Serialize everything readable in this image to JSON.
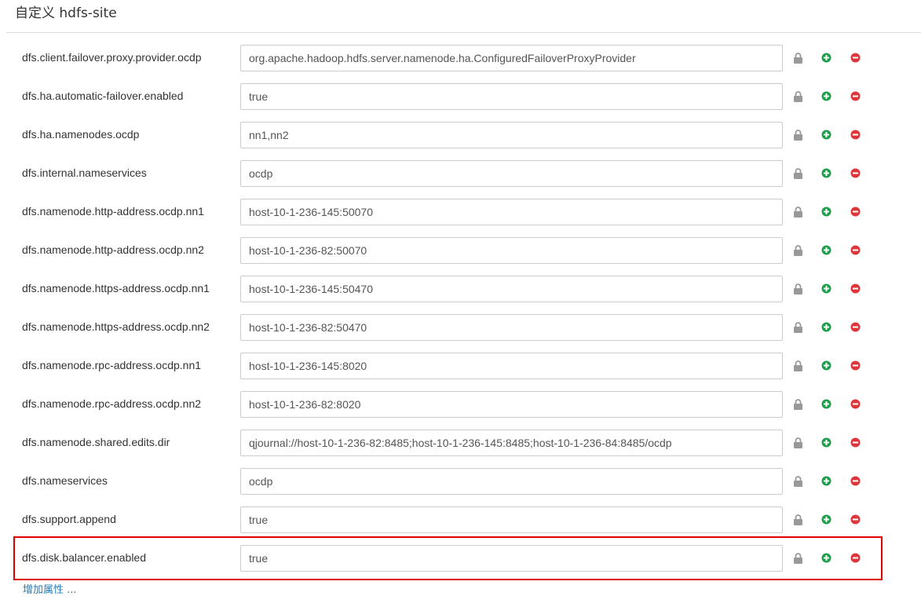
{
  "section": {
    "title": "自定义 hdfs-site",
    "add_property_label": "增加属性 ..."
  },
  "properties": [
    {
      "name": "dfs.client.failover.proxy.provider.ocdp",
      "value": "org.apache.hadoop.hdfs.server.namenode.ha.ConfiguredFailoverProxyProvider"
    },
    {
      "name": "dfs.ha.automatic-failover.enabled",
      "value": "true"
    },
    {
      "name": "dfs.ha.namenodes.ocdp",
      "value": "nn1,nn2"
    },
    {
      "name": "dfs.internal.nameservices",
      "value": "ocdp"
    },
    {
      "name": "dfs.namenode.http-address.ocdp.nn1",
      "value": "host-10-1-236-145:50070"
    },
    {
      "name": "dfs.namenode.http-address.ocdp.nn2",
      "value": "host-10-1-236-82:50070"
    },
    {
      "name": "dfs.namenode.https-address.ocdp.nn1",
      "value": "host-10-1-236-145:50470"
    },
    {
      "name": "dfs.namenode.https-address.ocdp.nn2",
      "value": "host-10-1-236-82:50470"
    },
    {
      "name": "dfs.namenode.rpc-address.ocdp.nn1",
      "value": "host-10-1-236-145:8020"
    },
    {
      "name": "dfs.namenode.rpc-address.ocdp.nn2",
      "value": "host-10-1-236-82:8020"
    },
    {
      "name": "dfs.namenode.shared.edits.dir",
      "value": "qjournal://host-10-1-236-82:8485;host-10-1-236-145:8485;host-10-1-236-84:8485/ocdp"
    },
    {
      "name": "dfs.nameservices",
      "value": "ocdp"
    },
    {
      "name": "dfs.support.append",
      "value": "true"
    },
    {
      "name": "dfs.disk.balancer.enabled",
      "value": "true"
    }
  ],
  "icons": {
    "lock": "lock-icon",
    "add": "plus-circle-icon",
    "remove": "minus-circle-icon"
  },
  "colors": {
    "lock": "#999999",
    "add": "#1e9e4a",
    "remove": "#e0353b",
    "highlight": "#e00000",
    "link": "#2a7ab0"
  }
}
